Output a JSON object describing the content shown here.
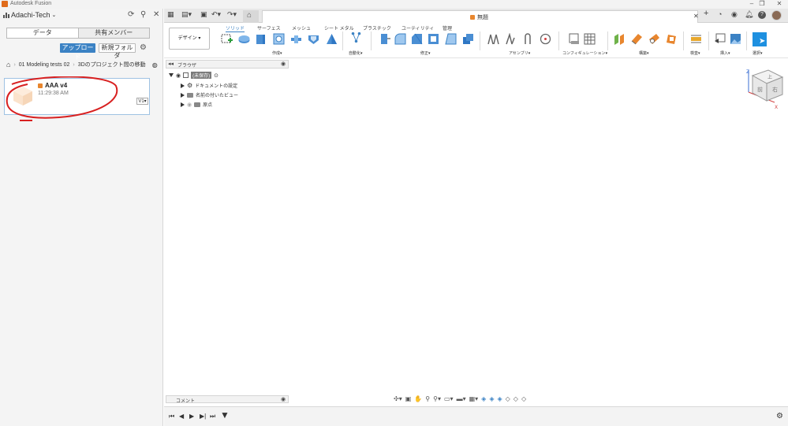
{
  "window": {
    "title": "Autodesk Fusion"
  },
  "left_panel": {
    "team_name": "Adachi-Tech",
    "tabs": [
      "データ",
      "共有メンバー"
    ],
    "upload_label": "アップロード",
    "new_folder_label": "新規フォルダ",
    "breadcrumb": [
      "01 Modeling tests 02",
      "3Dのプロジェクト間の移動"
    ],
    "files": [
      {
        "name": "AAA v4",
        "time": "11:29:38 AM",
        "version": "V1"
      }
    ]
  },
  "document_tab": {
    "title": "無題"
  },
  "toolbar": {
    "workspace": "デザイン",
    "tabs": [
      "ソリッド",
      "サーフェス",
      "メッシュ",
      "シート メタル",
      "プラスチック",
      "ユーティリティ",
      "管理"
    ],
    "active_tab": "ソリッド",
    "groups": [
      "作成",
      "自動化",
      "修正",
      "アセンブリ",
      "コンフィギュレーション",
      "構築",
      "検査",
      "挿入",
      "選択"
    ]
  },
  "browser": {
    "title": "ブラウザ",
    "root": "(未保存)",
    "items": [
      "ドキュメントの設定",
      "名前の付いたビュー",
      "原点"
    ]
  },
  "viewcube": {
    "top_label": "上",
    "front_label": "前",
    "right_label": "右",
    "axis_x": "X",
    "axis_z": "Z"
  },
  "comment_panel": {
    "title": "コメント"
  },
  "colors": {
    "accent": "#3b82c4",
    "annotation": "#d82020",
    "orange": "#e8862e"
  }
}
